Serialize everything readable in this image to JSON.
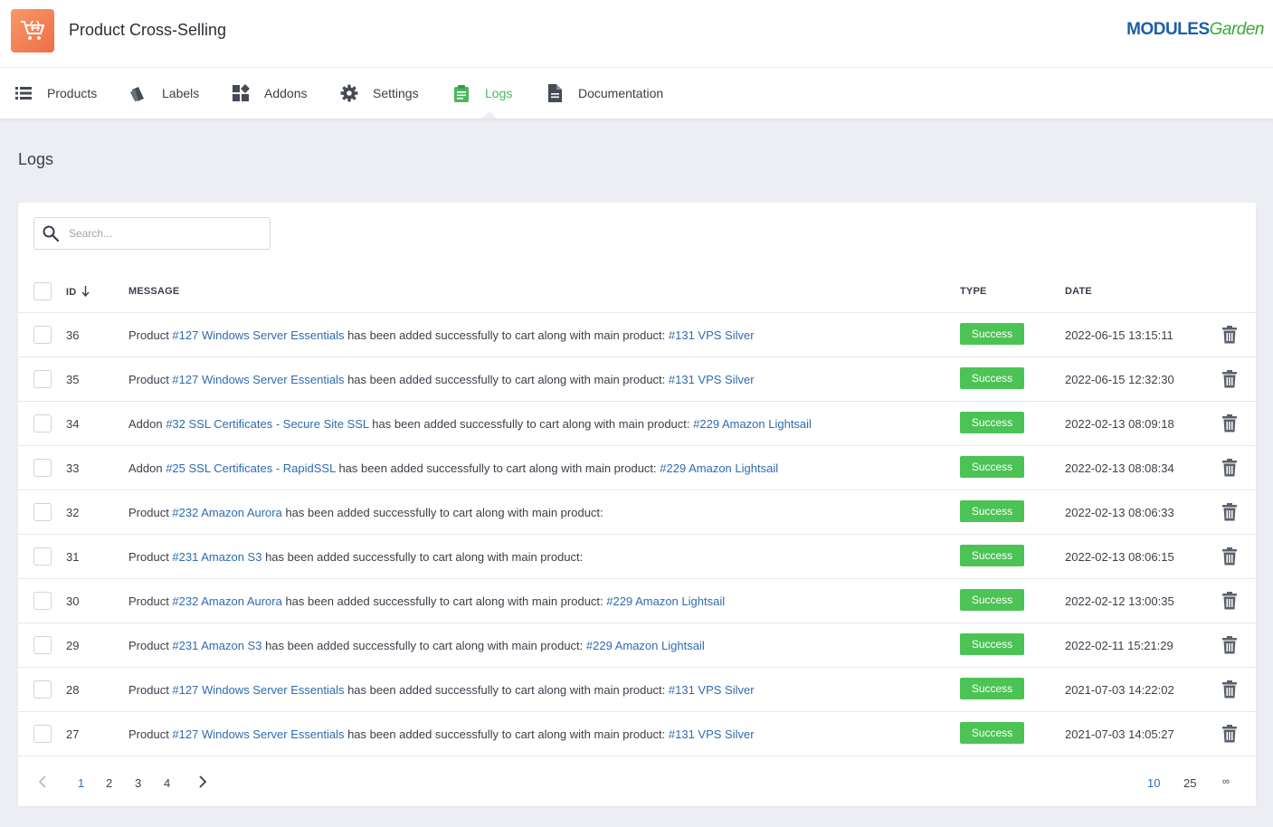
{
  "app": {
    "title": "Product Cross-Selling",
    "brand_m": "MODULES",
    "brand_g": "Garden"
  },
  "nav": [
    {
      "label": "Products",
      "icon": "list-icon"
    },
    {
      "label": "Labels",
      "icon": "tags-icon"
    },
    {
      "label": "Addons",
      "icon": "addons-icon"
    },
    {
      "label": "Settings",
      "icon": "gear-icon"
    },
    {
      "label": "Logs",
      "icon": "clipboard-icon",
      "active": true
    },
    {
      "label": "Documentation",
      "icon": "document-icon"
    }
  ],
  "page": {
    "title": "Logs"
  },
  "search": {
    "placeholder": "Search..."
  },
  "table": {
    "headers": {
      "id": "ID",
      "message": "MESSAGE",
      "type": "TYPE",
      "date": "DATE"
    },
    "rows": [
      {
        "id": "36",
        "parts": [
          [
            "t",
            "Product "
          ],
          [
            "a",
            "#127 Windows Server Essentials"
          ],
          [
            "t",
            " has been added successfully to cart along with main product: "
          ],
          [
            "a",
            "#131 VPS Silver"
          ]
        ],
        "type": "Success",
        "date": "2022-06-15 13:15:11"
      },
      {
        "id": "35",
        "parts": [
          [
            "t",
            "Product "
          ],
          [
            "a",
            "#127 Windows Server Essentials"
          ],
          [
            "t",
            " has been added successfully to cart along with main product: "
          ],
          [
            "a",
            "#131 VPS Silver"
          ]
        ],
        "type": "Success",
        "date": "2022-06-15 12:32:30"
      },
      {
        "id": "34",
        "parts": [
          [
            "t",
            "Addon "
          ],
          [
            "a",
            "#32 SSL Certificates - Secure Site SSL"
          ],
          [
            "t",
            " has been added successfully to cart along with main product: "
          ],
          [
            "a",
            "#229 Amazon Lightsail"
          ]
        ],
        "type": "Success",
        "date": "2022-02-13 08:09:18"
      },
      {
        "id": "33",
        "parts": [
          [
            "t",
            "Addon "
          ],
          [
            "a",
            "#25 SSL Certificates - RapidSSL"
          ],
          [
            "t",
            " has been added successfully to cart along with main product: "
          ],
          [
            "a",
            "#229 Amazon Lightsail"
          ]
        ],
        "type": "Success",
        "date": "2022-02-13 08:08:34"
      },
      {
        "id": "32",
        "parts": [
          [
            "t",
            "Product "
          ],
          [
            "a",
            "#232 Amazon Aurora"
          ],
          [
            "t",
            " has been added successfully to cart along with main product:"
          ]
        ],
        "type": "Success",
        "date": "2022-02-13 08:06:33"
      },
      {
        "id": "31",
        "parts": [
          [
            "t",
            "Product "
          ],
          [
            "a",
            "#231 Amazon S3"
          ],
          [
            "t",
            " has been added successfully to cart along with main product:"
          ]
        ],
        "type": "Success",
        "date": "2022-02-13 08:06:15"
      },
      {
        "id": "30",
        "parts": [
          [
            "t",
            "Product "
          ],
          [
            "a",
            "#232 Amazon Aurora"
          ],
          [
            "t",
            " has been added successfully to cart along with main product: "
          ],
          [
            "a",
            "#229 Amazon Lightsail"
          ]
        ],
        "type": "Success",
        "date": "2022-02-12 13:00:35"
      },
      {
        "id": "29",
        "parts": [
          [
            "t",
            "Product "
          ],
          [
            "a",
            "#231 Amazon S3"
          ],
          [
            "t",
            " has been added successfully to cart along with main product: "
          ],
          [
            "a",
            "#229 Amazon Lightsail"
          ]
        ],
        "type": "Success",
        "date": "2022-02-11 15:21:29"
      },
      {
        "id": "28",
        "parts": [
          [
            "t",
            "Product "
          ],
          [
            "a",
            "#127 Windows Server Essentials"
          ],
          [
            "t",
            " has been added successfully to cart along with main product: "
          ],
          [
            "a",
            "#131 VPS Silver"
          ]
        ],
        "type": "Success",
        "date": "2021-07-03 14:22:02"
      },
      {
        "id": "27",
        "parts": [
          [
            "t",
            "Product "
          ],
          [
            "a",
            "#127 Windows Server Essentials"
          ],
          [
            "t",
            " has been added successfully to cart along with main product: "
          ],
          [
            "a",
            "#131 VPS Silver"
          ]
        ],
        "type": "Success",
        "date": "2021-07-03 14:05:27"
      }
    ]
  },
  "pagination": {
    "pages": [
      "1",
      "2",
      "3",
      "4"
    ],
    "current": "1",
    "sizes": [
      "10",
      "25",
      "∞"
    ],
    "current_size": "10"
  },
  "colors": {
    "accent": "#49b85c",
    "link": "#2f6bb0",
    "success": "#4cc355",
    "logo": "#f06d45"
  }
}
